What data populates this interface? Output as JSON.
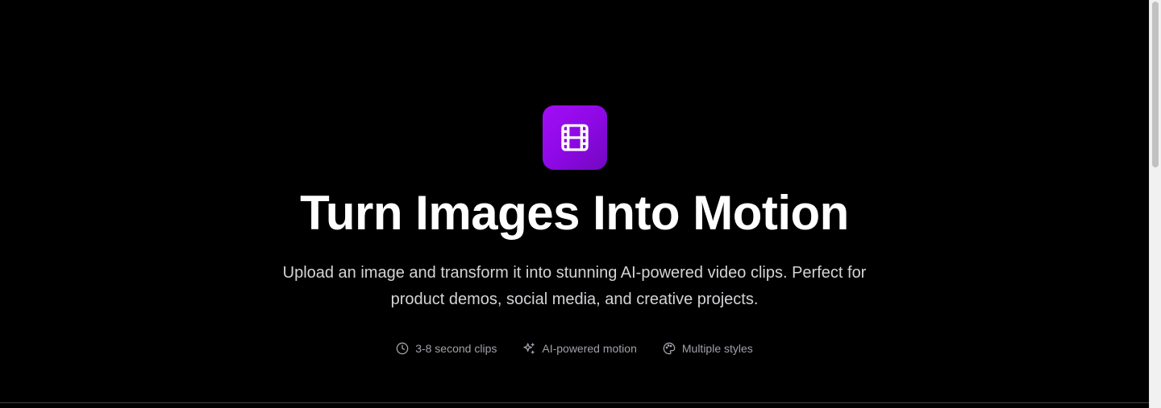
{
  "hero": {
    "logo_icon": "film-icon",
    "headline": "Turn Images Into Motion",
    "subtitle": "Upload an image and transform it into stunning AI-powered video clips. Perfect for product demos, social media, and creative projects.",
    "features": [
      {
        "icon": "clock-icon",
        "label": "3-8 second clips"
      },
      {
        "icon": "sparkles-icon",
        "label": "AI-powered motion"
      },
      {
        "icon": "palette-icon",
        "label": "Multiple styles"
      }
    ]
  },
  "colors": {
    "background": "#000000",
    "accent_start": "#a20ef5",
    "accent_end": "#7207bf",
    "headline": "#ffffff",
    "subtitle": "#d4d4d8",
    "feature_text": "#a1a1aa"
  }
}
